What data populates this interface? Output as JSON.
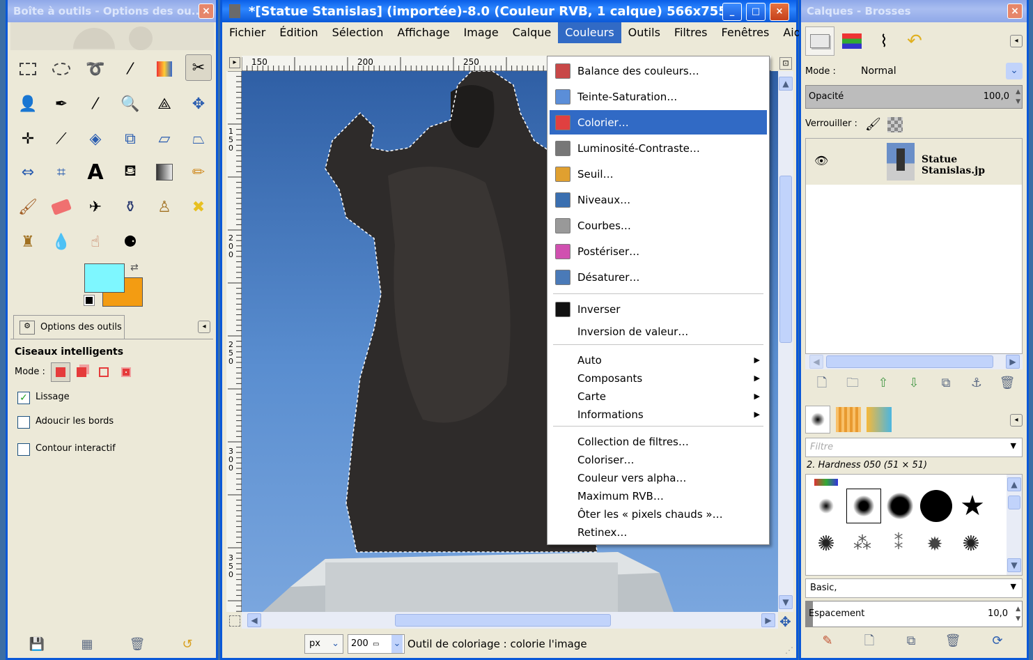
{
  "toolbox": {
    "title": "Boîte à outils - Options des ou...",
    "close": "×",
    "tab_label": "Options des outils",
    "tool_name": "Ciseaux intelligents",
    "mode_label": "Mode :",
    "options": [
      {
        "label": "Lissage",
        "checked": true
      },
      {
        "label": "Adoucir les bords",
        "checked": false
      },
      {
        "label": "Contour interactif",
        "checked": false
      }
    ],
    "fg_color": "#7ef7ff",
    "bg_color": "#f39c12"
  },
  "image_window": {
    "title": "*[Statue Stanislas] (importée)-8.0 (Couleur RVB, 1 calque) 566x755 ...",
    "menus": [
      "Fichier",
      "Édition",
      "Sélection",
      "Affichage",
      "Image",
      "Calque",
      "Couleurs",
      "Outils",
      "Filtres",
      "Fenêtres",
      "Aide"
    ],
    "open_menu": "Couleurs",
    "ruler_h": [
      "150",
      "200",
      "250"
    ],
    "ruler_v": [
      "150",
      "200",
      "250",
      "300",
      "350"
    ],
    "unit": "px",
    "zoom": "200",
    "status": "Outil de coloriage : colorie l'image",
    "minimize": "_",
    "maximize": "□",
    "close": "×"
  },
  "couleurs_menu": {
    "items": [
      {
        "label": "Balance des couleurs…",
        "icon": "color-balance-icon"
      },
      {
        "label": "Teinte-Saturation…",
        "icon": "hue-saturation-icon"
      },
      {
        "label": "Colorier…",
        "icon": "colorize-icon",
        "highlighted": true
      },
      {
        "label": "Luminosité-Contraste…",
        "icon": "brightness-contrast-icon"
      },
      {
        "label": "Seuil…",
        "icon": "threshold-icon"
      },
      {
        "label": "Niveaux…",
        "icon": "levels-icon"
      },
      {
        "label": "Courbes…",
        "icon": "curves-icon"
      },
      {
        "label": "Postériser…",
        "icon": "posterize-icon"
      },
      {
        "label": "Désaturer…",
        "icon": "desaturate-icon"
      }
    ],
    "invert_items": [
      {
        "label": "Inverser",
        "icon": "invert-icon"
      },
      {
        "label": "Inversion de valeur…"
      }
    ],
    "submenus": [
      "Auto",
      "Composants",
      "Carte",
      "Informations"
    ],
    "extra_items": [
      "Collection de filtres…",
      "Coloriser…",
      "Couleur vers alpha…",
      "Maximum RVB…",
      "Ôter les « pixels chauds »…",
      "Retinex…"
    ]
  },
  "layers": {
    "title": "Calques - Brosses",
    "close": "×",
    "mode_label": "Mode :",
    "mode_value": "Normal",
    "opacity_label": "Opacité",
    "opacity_value": "100,0",
    "lock_label": "Verrouiller :",
    "layer_name": "Statue Stanislas.jp"
  },
  "brushes": {
    "filter_placeholder": "Filtre",
    "selected_brush": "2. Hardness 050 (51 × 51)",
    "preset": "Basic,",
    "spacing_label": "Espacement",
    "spacing_value": "10,0"
  }
}
